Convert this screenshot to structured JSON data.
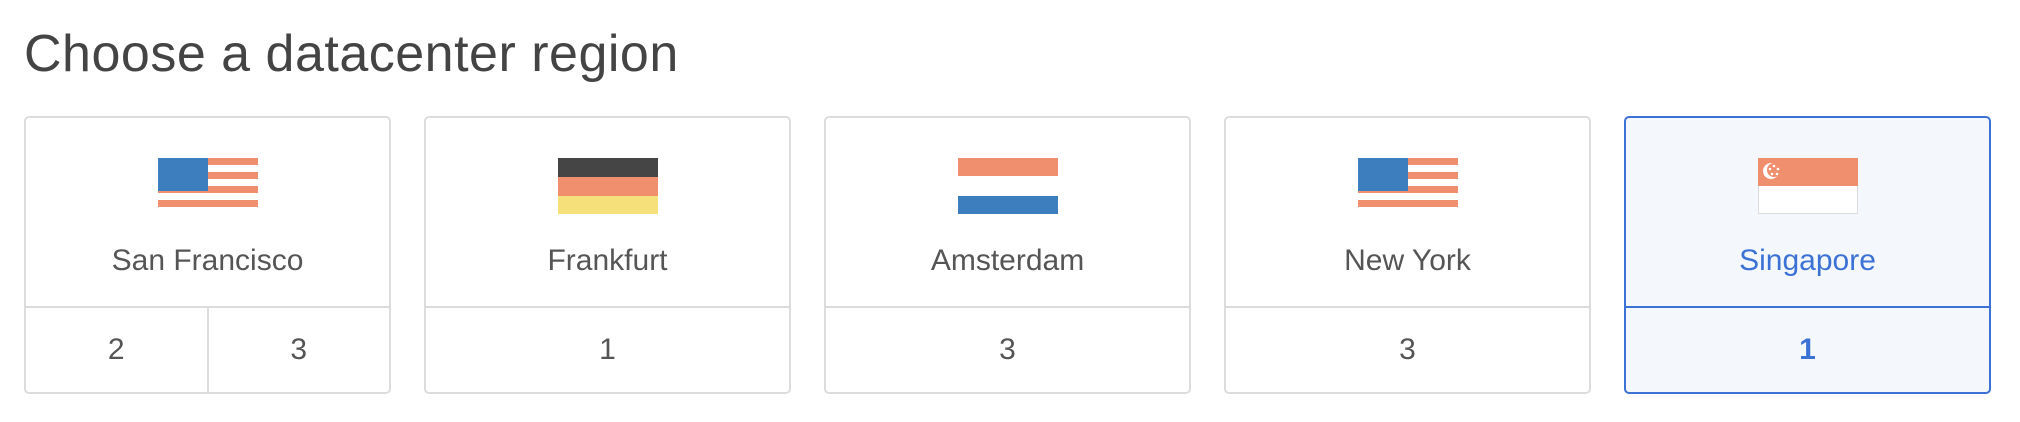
{
  "heading": "Choose a datacenter region",
  "colors": {
    "accent": "#3c72d6",
    "flag_blue": "#3d7ebf",
    "flag_stripe": "#f08f6e",
    "flag_black": "#454545",
    "flag_gold": "#f5e07a"
  },
  "regions": [
    {
      "city": "San Francisco",
      "flag": "us-flag-icon",
      "versions": [
        "2",
        "3"
      ],
      "selected": false
    },
    {
      "city": "Frankfurt",
      "flag": "germany-flag-icon",
      "versions": [
        "1"
      ],
      "selected": false
    },
    {
      "city": "Amsterdam",
      "flag": "netherlands-flag-icon",
      "versions": [
        "3"
      ],
      "selected": false
    },
    {
      "city": "New York",
      "flag": "us-flag-icon",
      "versions": [
        "3"
      ],
      "selected": false
    },
    {
      "city": "Singapore",
      "flag": "singapore-flag-icon",
      "versions": [
        "1"
      ],
      "selected": true
    }
  ]
}
